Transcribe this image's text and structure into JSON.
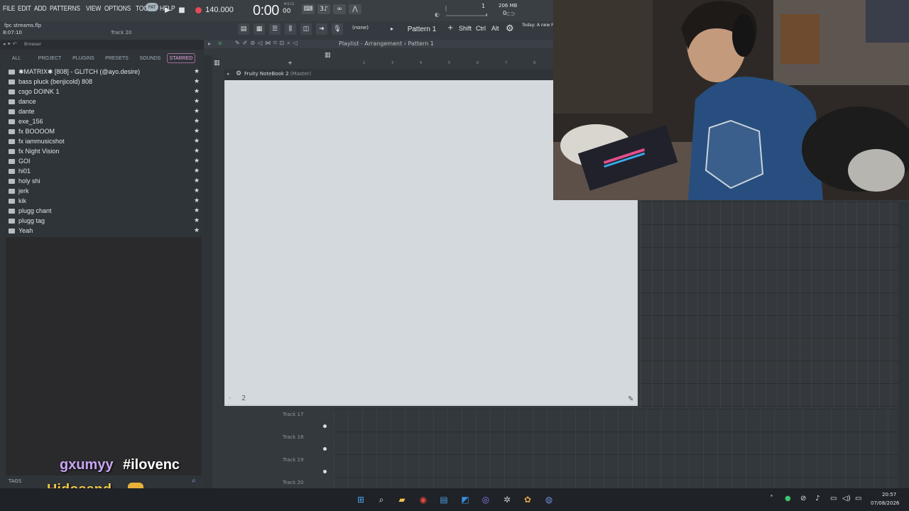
{
  "menu": [
    "FILE",
    "EDIT",
    "ADD",
    "PATTERNS",
    "VIEW",
    "OPTIONS",
    "TOOLS",
    "HELP"
  ],
  "transport": {
    "mode_label": "PAT",
    "tempo": "140.000",
    "time_main": "0:00",
    "time_sub": "00",
    "time_unit": "M:S:CS"
  },
  "system_meter": {
    "cpu": "1",
    "memory": "206 MB",
    "polyphony": "0"
  },
  "project": {
    "filename": "fpc streams.flp",
    "time": "8:07:10",
    "track_hint": "Track 20"
  },
  "toolbar2": {
    "snap": "(none)",
    "pattern": "Pattern 1",
    "shift": "Shift",
    "ctrl": "Ctrl",
    "alt": "Alt",
    "news": "Today: A new FL Studio is a"
  },
  "browser": {
    "title": "Browser",
    "tabs": {
      "all": "ALL",
      "project": "PROJECT",
      "plugins": "PLUGINS",
      "presets": "PRESETS",
      "sounds": "SOUNDS",
      "starred": "STARRED"
    },
    "items": [
      {
        "label": "✱MATRIX✱ [808] - GLITCH (@ayo.desire)",
        "kind": "folder"
      },
      {
        "label": "bass pluck (benjicold) 808",
        "kind": "folder"
      },
      {
        "label": "csgo DOINK 1",
        "kind": "file"
      },
      {
        "label": "dance",
        "kind": "file"
      },
      {
        "label": "dante",
        "kind": "file"
      },
      {
        "label": "exe_156",
        "kind": "file"
      },
      {
        "label": "fx BOOOOM",
        "kind": "file"
      },
      {
        "label": "fx iammusicshot",
        "kind": "file"
      },
      {
        "label": "fx Night Vision",
        "kind": "file"
      },
      {
        "label": "GOI",
        "kind": "file"
      },
      {
        "label": "hi01",
        "kind": "file"
      },
      {
        "label": "holy shi",
        "kind": "file"
      },
      {
        "label": "jerk",
        "kind": "file"
      },
      {
        "label": "kik",
        "kind": "file"
      },
      {
        "label": "plugg chant",
        "kind": "file"
      },
      {
        "label": "plugg tag",
        "kind": "file"
      },
      {
        "label": "Yeah",
        "kind": "file"
      }
    ],
    "tags_label": "TAGS"
  },
  "playlist": {
    "title": "Playlist - Arrangement › Pattern 1",
    "ruler": [
      "2",
      "3",
      "4",
      "5",
      "6",
      "7",
      "8"
    ],
    "tracks": [
      "Track 17",
      "Track 18",
      "Track 19",
      "Track 20"
    ]
  },
  "notebook": {
    "title": "Fruity NoteBook 2",
    "subtitle": "(Master)",
    "page": "2"
  },
  "overlay": {
    "chat_user": "gxumyy",
    "chat_tag": "#ilovenc",
    "chat_message": "Hidosend"
  },
  "tray": {
    "time": "20:57",
    "date": "07/08/2026"
  },
  "colors": {
    "record": "#e34b57",
    "starred_accent": "#e6a7df",
    "chat_user": "#c8a6f5",
    "chat_message": "#f1c84a"
  }
}
